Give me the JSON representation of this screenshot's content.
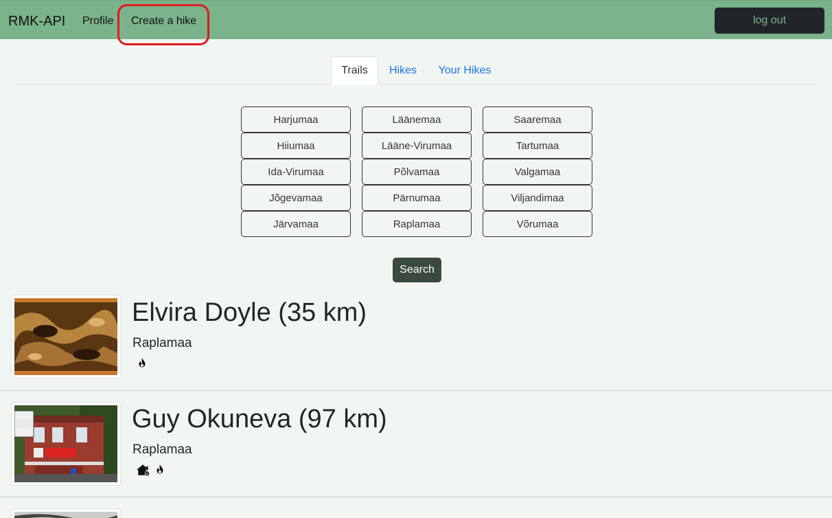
{
  "navbar": {
    "brand": "RMK-API",
    "links": [
      {
        "label": "Profile"
      },
      {
        "label": "Create a hike"
      }
    ],
    "logout_label": "log out"
  },
  "tabs": [
    {
      "label": "Trails",
      "active": true
    },
    {
      "label": "Hikes",
      "active": false
    },
    {
      "label": "Your Hikes",
      "active": false
    }
  ],
  "regions": [
    [
      "Harjumaa",
      "Läänemaa",
      "Saaremaa"
    ],
    [
      "Hiiumaa",
      "Lääne-Virumaa",
      "Tartumaa"
    ],
    [
      "Ida-Virumaa",
      "Põlvamaa",
      "Valgamaa"
    ],
    [
      "Jõgevamaa",
      "Pärnumaa",
      "Viljandimaa"
    ],
    [
      "Järvamaa",
      "Raplamaa",
      "Võrumaa"
    ]
  ],
  "search_label": "Search",
  "hikes": [
    {
      "title": "Elvira Doyle (35 km)",
      "region": "Raplamaa",
      "icons": [
        "fire-icon"
      ]
    },
    {
      "title": "Guy Okuneva (97 km)",
      "region": "Raplamaa",
      "icons": [
        "house-fire-icon",
        "fire-icon"
      ]
    }
  ],
  "colors": {
    "navbar": "#7bb38a",
    "link": "#1a73e8",
    "highlight": "#e0191f",
    "background": "#f1f6f3"
  }
}
